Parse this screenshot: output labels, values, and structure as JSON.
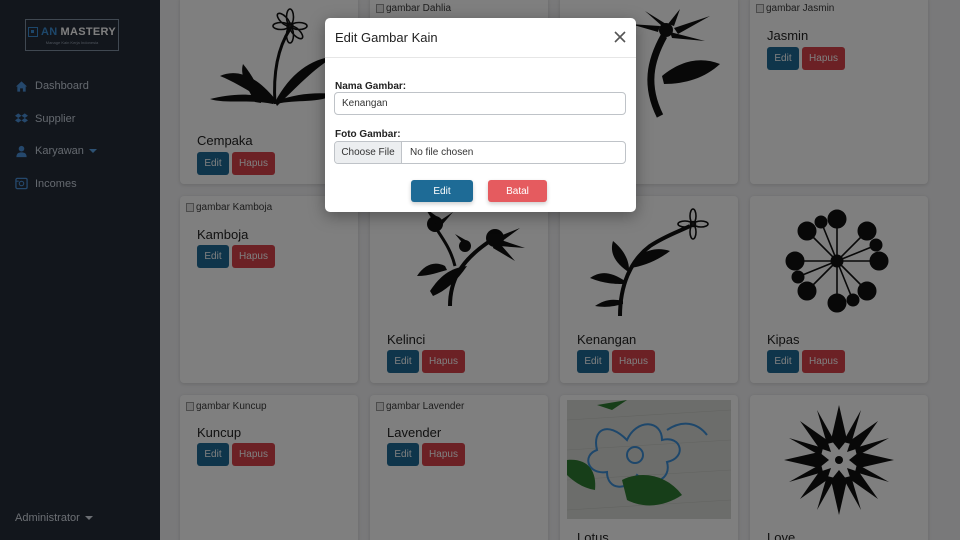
{
  "brand": {
    "logo_prefix": "AN",
    "logo_main": "MASTERY",
    "logo_sub": "Manage Kain Kerja Indonesia"
  },
  "sidebar": {
    "items": [
      {
        "label": "Dashboard",
        "icon": "home-icon"
      },
      {
        "label": "Supplier",
        "icon": "dropbox-icon"
      },
      {
        "label": "Karyawan",
        "icon": "user-icon",
        "has_dropdown": true
      },
      {
        "label": "Incomes",
        "icon": "income-icon"
      }
    ],
    "user": "Administrator"
  },
  "cards": [
    {
      "title": "Cempaka",
      "image_alt": "",
      "image": "flower-drawing"
    },
    {
      "title": "",
      "image_alt": "gambar Dahlia"
    },
    {
      "title": "",
      "image": "flower-drawing"
    },
    {
      "title": "Jasmin",
      "image_alt": "gambar Jasmin"
    },
    {
      "title": "Kamboja",
      "image_alt": "gambar Kamboja"
    },
    {
      "title": "Kelinci",
      "image": "flower-drawing"
    },
    {
      "title": "Kenangan",
      "image": "flower-drawing"
    },
    {
      "title": "Kipas",
      "image": "flower-drawing"
    },
    {
      "title": "Kuncup",
      "image_alt": "gambar Kuncup"
    },
    {
      "title": "Lavender",
      "image_alt": "gambar Lavender"
    },
    {
      "title": "Lotus",
      "image": "photo"
    },
    {
      "title": "Love",
      "image": "flower-drawing"
    }
  ],
  "card_buttons": {
    "edit": "Edit",
    "delete": "Hapus"
  },
  "modal": {
    "title": "Edit Gambar Kain",
    "name_label": "Nama Gambar:",
    "name_value": "Kenangan",
    "file_label": "Foto Gambar:",
    "file_button": "Choose File",
    "file_status": "No file chosen",
    "edit_button": "Edit",
    "cancel_button": "Batal"
  },
  "colors": {
    "sidebar": "#242c38",
    "edit": "#1e6b96",
    "delete": "#d9434b",
    "cancel": "#e55b5f"
  }
}
